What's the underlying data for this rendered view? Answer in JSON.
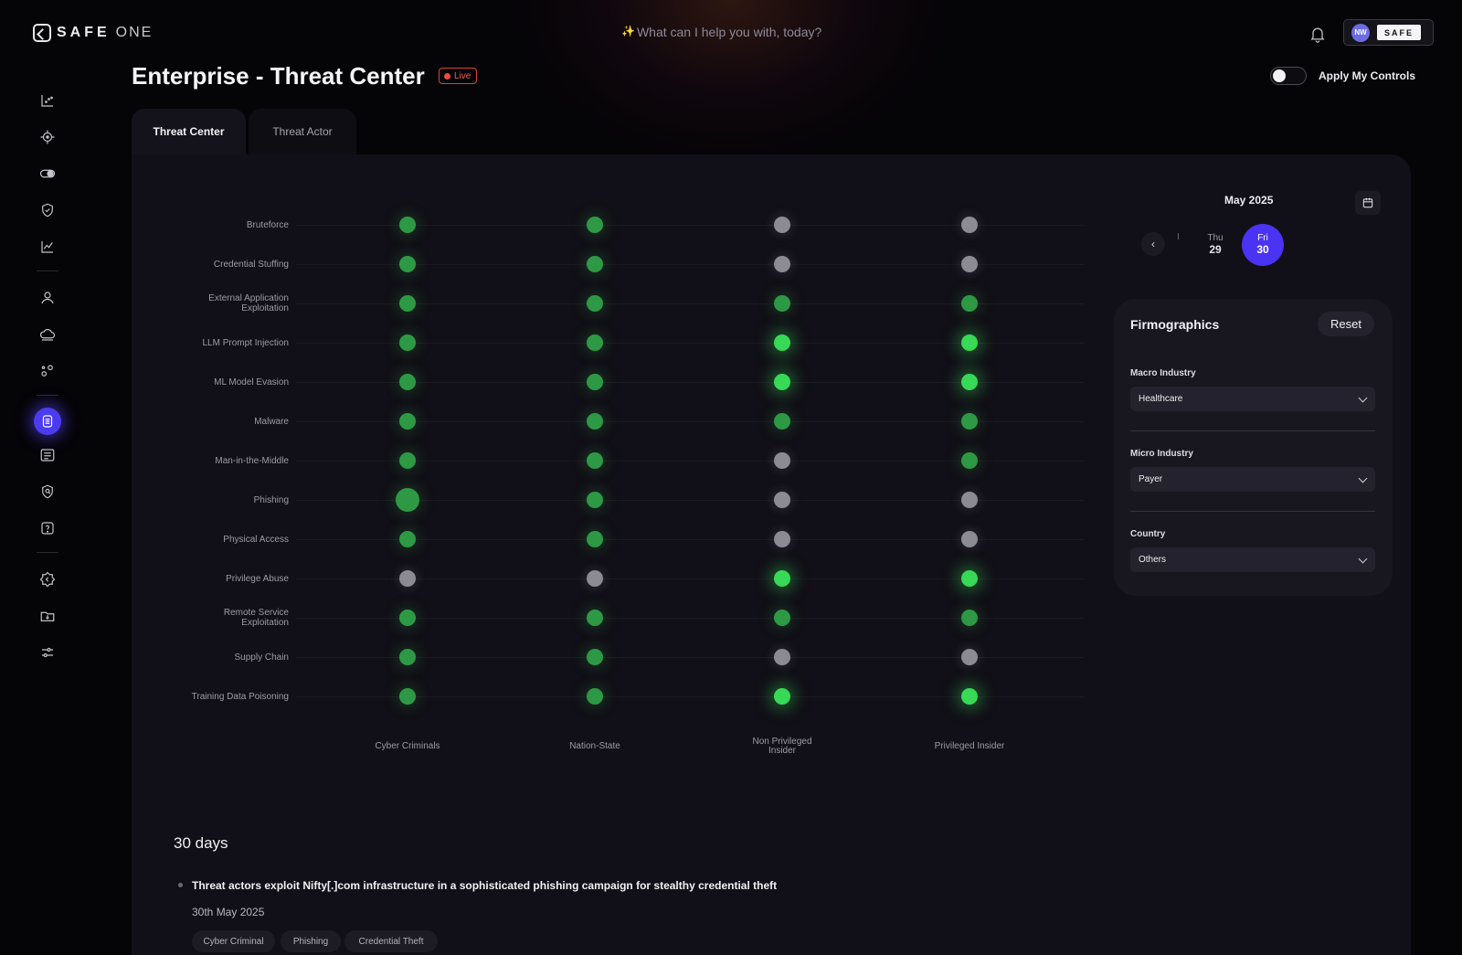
{
  "app": {
    "brand": "SAFE",
    "brand_sub": "ONE"
  },
  "search": {
    "placeholder": "What can I help you with, today?"
  },
  "user": {
    "initials": "NW",
    "org": "SAFE"
  },
  "header": {
    "title": "Enterprise - Threat Center",
    "live_label": "Live",
    "toggle_label": "Apply My Controls",
    "toggle_on": false
  },
  "tabs": [
    {
      "label": "Threat Center",
      "active": true
    },
    {
      "label": "Threat Actor",
      "active": false
    }
  ],
  "sidebar": {
    "icons": [
      "dashboard-icon",
      "target-icon",
      "toggle-icon",
      "shield-check-icon",
      "trend-chart-icon",
      "user-icon",
      "cloud-icon",
      "nodes-icon",
      "threat-center-icon",
      "list-icon",
      "shield-search-icon",
      "help-icon",
      "settings-icon",
      "download-folder-icon",
      "sliders-icon"
    ],
    "active": "threat-center-icon"
  },
  "colors": {
    "accent": "#4a33f2",
    "green": "#2e9945",
    "bright_green": "#37d957",
    "neutral": "#8c8b94",
    "live": "#ef4b3f"
  },
  "chart_data": {
    "type": "scatter",
    "legend_states": {
      "g": "green",
      "b": "bright-green",
      "n": "grey"
    },
    "x_categories": [
      "Cyber Criminals",
      "Nation-State",
      "Non Privileged Insider",
      "Privileged Insider"
    ],
    "y_categories": [
      "Bruteforce",
      "Credential Stuffing",
      "External Application Exploitation",
      "LLM Prompt Injection",
      "ML Model Evasion",
      "Malware",
      "Man-in-the-Middle",
      "Phishing",
      "Physical Access",
      "Privilege Abuse",
      "Remote Service Exploitation",
      "Supply Chain",
      "Training Data Poisoning"
    ],
    "matrix": [
      [
        "g",
        "g",
        "n",
        "n"
      ],
      [
        "g",
        "g",
        "n",
        "n"
      ],
      [
        "g",
        "g",
        "g",
        "g"
      ],
      [
        "g",
        "g",
        "b",
        "b"
      ],
      [
        "g",
        "g",
        "b",
        "b"
      ],
      [
        "g",
        "g",
        "g",
        "g"
      ],
      [
        "g",
        "g",
        "n",
        "g"
      ],
      [
        "g",
        "g",
        "n",
        "n"
      ],
      [
        "g",
        "g",
        "n",
        "n"
      ],
      [
        "n",
        "n",
        "b",
        "b"
      ],
      [
        "g",
        "g",
        "g",
        "g"
      ],
      [
        "g",
        "g",
        "n",
        "n"
      ],
      [
        "g",
        "g",
        "b",
        "b"
      ]
    ],
    "highlight": {
      "row": "Phishing",
      "column": "Cyber Criminals"
    }
  },
  "calendar": {
    "month": "May 2025",
    "days": [
      {
        "weekday": "Thu",
        "day": "29",
        "selected": false
      },
      {
        "weekday": "Fri",
        "day": "30",
        "selected": true
      }
    ]
  },
  "firmographics": {
    "title": "Firmographics",
    "reset_label": "Reset",
    "fields": [
      {
        "label": "Macro Industry",
        "value": "Healthcare"
      },
      {
        "label": "Micro Industry",
        "value": "Payer"
      },
      {
        "label": "Country",
        "value": "Others"
      }
    ]
  },
  "news": {
    "section_title": "30 days",
    "items": [
      {
        "title": "Threat actors exploit Nifty[.]com infrastructure in a sophisticated phishing campaign for stealthy credential theft",
        "date": "30th May 2025",
        "tags": [
          "Cyber Criminal",
          "Phishing",
          "Credential Theft"
        ]
      }
    ]
  }
}
